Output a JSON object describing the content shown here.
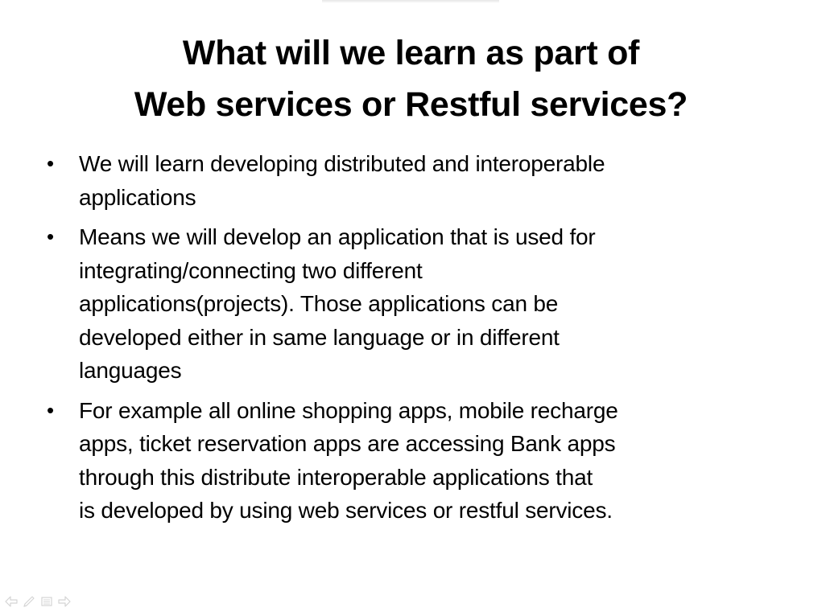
{
  "slide": {
    "title_lines": [
      "What will we learn as part of",
      "Web services or Restful services?"
    ],
    "bullet_symbol": "•",
    "bullets": [
      {
        "lines": [
          "We will learn developing distributed and interoperable",
          "applications"
        ]
      },
      {
        "lines": [
          "Means we will develop an application that is used for",
          "integrating/connecting two different",
          "applications(projects). Those applications can be",
          "developed either in same language or in different",
          "languages"
        ]
      },
      {
        "lines": [
          "For example all online shopping apps, mobile recharge",
          "apps, ticket reservation apps are accessing Bank apps",
          "through this distribute interoperable applications that",
          "is developed by using web services or restful services."
        ]
      }
    ]
  },
  "nav": {
    "icons": [
      "previous-slide-icon",
      "pen-icon",
      "menu-icon",
      "next-slide-icon"
    ],
    "icon_color": "#d4d4d4"
  }
}
